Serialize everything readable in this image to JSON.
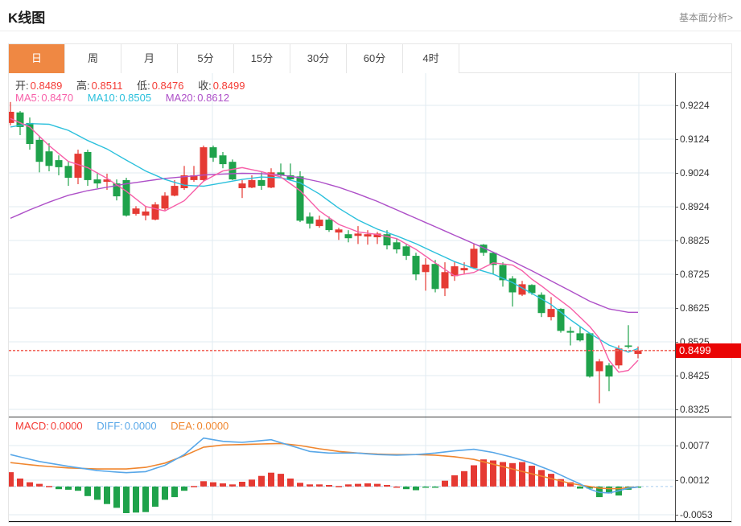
{
  "header": {
    "title": "K线图",
    "link": "基本面分析>"
  },
  "tabs": {
    "items": [
      "日",
      "周",
      "月",
      "5分",
      "15分",
      "30分",
      "60分",
      "4时"
    ],
    "active": 0
  },
  "legend": {
    "ohlc": [
      {
        "label": "开:",
        "value": "0.8489"
      },
      {
        "label": "高:",
        "value": "0.8511"
      },
      {
        "label": "低:",
        "value": "0.8476"
      },
      {
        "label": "收:",
        "value": "0.8499"
      }
    ],
    "ma": [
      {
        "label": "MA5:",
        "value": "0.8470"
      },
      {
        "label": "MA10:",
        "value": "0.8505"
      },
      {
        "label": "MA20:",
        "value": "0.8612"
      }
    ],
    "macd": [
      {
        "label": "MACD:",
        "value": "0.0000"
      },
      {
        "label": "DIFF:",
        "value": "0.0000"
      },
      {
        "label": "DEA:",
        "value": "0.0000"
      }
    ]
  },
  "colors": {
    "up": "#e53a33",
    "down": "#1fa24b",
    "ma5": "#f75fa8",
    "ma10": "#2bc0dc",
    "ma20": "#ae50c8",
    "diff": "#58a7e8",
    "dea": "#f0862e",
    "ohlc_value": "#f43b35",
    "grid": "#e2ebf2",
    "zero_line": "#a8cdf0",
    "dotted_line": "#f26a60",
    "badge_bg": "#ea0505",
    "axis_line": "#4a4a4a",
    "tick_text": "#333333",
    "tab_active_bg": "#ef8843"
  },
  "chart_data": {
    "type": "candlestick+macd",
    "main": {
      "y_ticks": [
        0.9224,
        0.9124,
        0.9024,
        0.8924,
        0.8825,
        0.8725,
        0.8625,
        0.8525,
        0.8425,
        0.8325
      ],
      "current_price": 0.8499,
      "candles": [
        [
          0.9172,
          0.9234,
          0.9165,
          0.9205
        ],
        [
          0.9203,
          0.9207,
          0.9136,
          0.916
        ],
        [
          0.9172,
          0.9188,
          0.9093,
          0.911
        ],
        [
          0.9122,
          0.9134,
          0.9026,
          0.9057
        ],
        [
          0.9088,
          0.9112,
          0.9029,
          0.9045
        ],
        [
          0.9062,
          0.9076,
          0.9017,
          0.9041
        ],
        [
          0.9045,
          0.9057,
          0.8986,
          0.901
        ],
        [
          0.901,
          0.9093,
          0.8991,
          0.9081
        ],
        [
          0.9086,
          0.9093,
          0.8986,
          0.9003
        ],
        [
          0.9005,
          0.9026,
          0.8979,
          0.8993
        ],
        [
          0.8998,
          0.9022,
          0.8974,
          0.9005
        ],
        [
          0.8993,
          0.9005,
          0.8943,
          0.8955
        ],
        [
          0.9003,
          0.901,
          0.8895,
          0.8898
        ],
        [
          0.8903,
          0.8926,
          0.8898,
          0.8919
        ],
        [
          0.8898,
          0.8926,
          0.8884,
          0.891
        ],
        [
          0.8886,
          0.8938,
          0.8884,
          0.8931
        ],
        [
          0.8919,
          0.8967,
          0.8914,
          0.8957
        ],
        [
          0.8957,
          0.9003,
          0.8955,
          0.8986
        ],
        [
          0.8979,
          0.9045,
          0.8974,
          0.9017
        ],
        [
          0.9003,
          0.9045,
          0.8998,
          0.9017
        ],
        [
          0.9003,
          0.9105,
          0.8998,
          0.91
        ],
        [
          0.91,
          0.9105,
          0.9057,
          0.9069
        ],
        [
          0.9076,
          0.9086,
          0.9038,
          0.905
        ],
        [
          0.9057,
          0.9064,
          0.9003,
          0.9005
        ],
        [
          0.8979,
          0.9003,
          0.895,
          0.8993
        ],
        [
          0.8981,
          0.9017,
          0.8979,
          0.9003
        ],
        [
          0.9003,
          0.9026,
          0.8974,
          0.8986
        ],
        [
          0.8981,
          0.9038,
          0.8979,
          0.9026
        ],
        [
          0.9026,
          0.9052,
          0.901,
          0.9017
        ],
        [
          0.9017,
          0.9052,
          0.9003,
          0.9005
        ],
        [
          0.9014,
          0.9029,
          0.8879,
          0.8883
        ],
        [
          0.8895,
          0.8907,
          0.886,
          0.8874
        ],
        [
          0.8867,
          0.8898,
          0.8862,
          0.8886
        ],
        [
          0.8886,
          0.8895,
          0.885,
          0.8855
        ],
        [
          0.8848,
          0.8862,
          0.8826,
          0.8857
        ],
        [
          0.8843,
          0.8855,
          0.8819,
          0.8831
        ],
        [
          0.8838,
          0.8867,
          0.8814,
          0.8845
        ],
        [
          0.8836,
          0.8855,
          0.8812,
          0.8843
        ],
        [
          0.8834,
          0.885,
          0.8814,
          0.8845
        ],
        [
          0.8843,
          0.8855,
          0.8798,
          0.881
        ],
        [
          0.8819,
          0.8831,
          0.8786,
          0.8798
        ],
        [
          0.8807,
          0.8814,
          0.8767,
          0.8779
        ],
        [
          0.8779,
          0.8788,
          0.8707,
          0.8724
        ],
        [
          0.8731,
          0.8772,
          0.8676,
          0.8753
        ],
        [
          0.8755,
          0.8767,
          0.8671,
          0.8681
        ],
        [
          0.8683,
          0.876,
          0.866,
          0.8731
        ],
        [
          0.8719,
          0.876,
          0.8705,
          0.8748
        ],
        [
          0.8736,
          0.876,
          0.8724,
          0.8743
        ],
        [
          0.8743,
          0.8814,
          0.874,
          0.88
        ],
        [
          0.8812,
          0.8814,
          0.8779,
          0.8788
        ],
        [
          0.8788,
          0.8791,
          0.8724,
          0.8752
        ],
        [
          0.8752,
          0.876,
          0.8688,
          0.8707
        ],
        [
          0.8712,
          0.8719,
          0.8629,
          0.8671
        ],
        [
          0.8664,
          0.8705,
          0.866,
          0.8695
        ],
        [
          0.8693,
          0.8695,
          0.8664,
          0.8669
        ],
        [
          0.8664,
          0.8671,
          0.8598,
          0.861
        ],
        [
          0.8598,
          0.8657,
          0.8588,
          0.8622
        ],
        [
          0.8622,
          0.8624,
          0.8552,
          0.8557
        ],
        [
          0.8557,
          0.8569,
          0.8514,
          0.8552
        ],
        [
          0.855,
          0.8569,
          0.8526,
          0.8529
        ],
        [
          0.855,
          0.8552,
          0.8419,
          0.8422
        ],
        [
          0.8438,
          0.8474,
          0.8343,
          0.8467
        ],
        [
          0.8455,
          0.8462,
          0.8379,
          0.8422
        ],
        [
          0.8455,
          0.8514,
          0.8445,
          0.8505
        ],
        [
          0.8514,
          0.8574,
          0.8505,
          0.851
        ],
        [
          0.8489,
          0.8511,
          0.8476,
          0.8499
        ]
      ],
      "ma5_points": [
        [
          0,
          0.9185
        ],
        [
          2,
          0.916
        ],
        [
          4,
          0.9105
        ],
        [
          6,
          0.9058
        ],
        [
          8,
          0.904
        ],
        [
          10,
          0.9008
        ],
        [
          12,
          0.897
        ],
        [
          14,
          0.8925
        ],
        [
          16,
          0.8912
        ],
        [
          18,
          0.8942
        ],
        [
          20,
          0.9
        ],
        [
          22,
          0.903
        ],
        [
          24,
          0.904
        ],
        [
          26,
          0.9028
        ],
        [
          28,
          0.9012
        ],
        [
          30,
          0.8972
        ],
        [
          32,
          0.8912
        ],
        [
          34,
          0.8872
        ],
        [
          36,
          0.885
        ],
        [
          38,
          0.8842
        ],
        [
          40,
          0.883
        ],
        [
          42,
          0.8798
        ],
        [
          44,
          0.8758
        ],
        [
          46,
          0.872
        ],
        [
          48,
          0.873
        ],
        [
          50,
          0.8758
        ],
        [
          52,
          0.8752
        ],
        [
          53,
          0.8735
        ],
        [
          54,
          0.871
        ],
        [
          55,
          0.869
        ],
        [
          56,
          0.8668
        ],
        [
          58,
          0.8625
        ],
        [
          60,
          0.857
        ],
        [
          61,
          0.8535
        ],
        [
          62,
          0.847
        ],
        [
          63,
          0.8435
        ],
        [
          64,
          0.844
        ],
        [
          65,
          0.847
        ]
      ],
      "ma10_points": [
        [
          0,
          0.916
        ],
        [
          2,
          0.917
        ],
        [
          4,
          0.9168
        ],
        [
          6,
          0.915
        ],
        [
          8,
          0.912
        ],
        [
          10,
          0.9095
        ],
        [
          12,
          0.9062
        ],
        [
          14,
          0.903
        ],
        [
          16,
          0.9005
        ],
        [
          18,
          0.8988
        ],
        [
          20,
          0.8985
        ],
        [
          22,
          0.8995
        ],
        [
          24,
          0.9005
        ],
        [
          26,
          0.9012
        ],
        [
          28,
          0.901
        ],
        [
          30,
          0.8995
        ],
        [
          32,
          0.8962
        ],
        [
          34,
          0.892
        ],
        [
          36,
          0.8885
        ],
        [
          38,
          0.8858
        ],
        [
          40,
          0.8838
        ],
        [
          42,
          0.8815
        ],
        [
          44,
          0.8788
        ],
        [
          46,
          0.8762
        ],
        [
          48,
          0.8742
        ],
        [
          50,
          0.8725
        ],
        [
          52,
          0.87
        ],
        [
          54,
          0.8668
        ],
        [
          56,
          0.8635
        ],
        [
          58,
          0.859
        ],
        [
          60,
          0.855
        ],
        [
          62,
          0.8515
        ],
        [
          64,
          0.8494
        ],
        [
          65,
          0.8505
        ]
      ],
      "ma20_points": [
        [
          0,
          0.889
        ],
        [
          2,
          0.8915
        ],
        [
          4,
          0.8938
        ],
        [
          6,
          0.8958
        ],
        [
          8,
          0.8972
        ],
        [
          10,
          0.8982
        ],
        [
          12,
          0.8992
        ],
        [
          14,
          0.9
        ],
        [
          16,
          0.9008
        ],
        [
          18,
          0.9013
        ],
        [
          20,
          0.9018
        ],
        [
          22,
          0.9021
        ],
        [
          24,
          0.9023
        ],
        [
          26,
          0.9022
        ],
        [
          28,
          0.9018
        ],
        [
          30,
          0.901
        ],
        [
          32,
          0.8998
        ],
        [
          34,
          0.8982
        ],
        [
          36,
          0.8962
        ],
        [
          38,
          0.894
        ],
        [
          40,
          0.8915
        ],
        [
          42,
          0.889
        ],
        [
          44,
          0.8865
        ],
        [
          46,
          0.884
        ],
        [
          48,
          0.8815
        ],
        [
          50,
          0.879
        ],
        [
          52,
          0.8763
        ],
        [
          54,
          0.8735
        ],
        [
          56,
          0.8705
        ],
        [
          58,
          0.8675
        ],
        [
          60,
          0.8645
        ],
        [
          62,
          0.8622
        ],
        [
          64,
          0.8612
        ],
        [
          65,
          0.8612
        ]
      ]
    },
    "macd": {
      "y_ticks": [
        0.0077,
        0.0012,
        -0.0053
      ],
      "histogram": [
        0.0027,
        0.0015,
        0.0008,
        0.0005,
        0.0001,
        -0.0005,
        -0.0006,
        -0.0008,
        -0.0018,
        -0.0025,
        -0.0033,
        -0.004,
        -0.005,
        -0.0049,
        -0.0048,
        -0.0038,
        -0.0025,
        -0.002,
        -0.0008,
        0.0001,
        0.001,
        0.0008,
        0.0006,
        0.0004,
        0.0009,
        0.0013,
        0.002,
        0.0026,
        0.0024,
        0.0015,
        0.0007,
        0.0004,
        0.0004,
        0.0003,
        0.0001,
        0.0004,
        0.0005,
        0.0006,
        0.0005,
        0.0003,
        0.0,
        -0.0005,
        -0.0007,
        -0.0002,
        -0.0001,
        0.0011,
        0.0021,
        0.0029,
        0.004,
        0.0051,
        0.0049,
        0.0046,
        0.0044,
        0.0046,
        0.0039,
        0.0031,
        0.0024,
        0.0014,
        0.0008,
        -0.0004,
        -0.0004,
        -0.002,
        -0.0013,
        -0.0017,
        -0.0006,
        -0.0002
      ],
      "diff_points": [
        [
          0,
          0.006
        ],
        [
          3,
          0.0047
        ],
        [
          6,
          0.0038
        ],
        [
          9,
          0.003
        ],
        [
          12,
          0.0026
        ],
        [
          14,
          0.0028
        ],
        [
          16,
          0.004
        ],
        [
          18,
          0.006
        ],
        [
          20,
          0.0091
        ],
        [
          22,
          0.0085
        ],
        [
          24,
          0.0083
        ],
        [
          27,
          0.0088
        ],
        [
          29,
          0.0077
        ],
        [
          31,
          0.0066
        ],
        [
          33,
          0.0063
        ],
        [
          36,
          0.0063
        ],
        [
          38,
          0.006
        ],
        [
          40,
          0.0059
        ],
        [
          42,
          0.006
        ],
        [
          44,
          0.0063
        ],
        [
          46,
          0.0067
        ],
        [
          48,
          0.007
        ],
        [
          50,
          0.0064
        ],
        [
          52,
          0.0055
        ],
        [
          54,
          0.0044
        ],
        [
          56,
          0.003
        ],
        [
          58,
          0.0013
        ],
        [
          59,
          0.0005
        ],
        [
          60,
          -0.0005
        ],
        [
          61,
          -0.0011
        ],
        [
          62,
          -0.0012
        ],
        [
          63,
          -0.0008
        ],
        [
          64,
          -0.0003
        ],
        [
          65,
          -0.0001
        ]
      ],
      "dea_points": [
        [
          0,
          0.0045
        ],
        [
          3,
          0.0039
        ],
        [
          6,
          0.0035
        ],
        [
          9,
          0.0033
        ],
        [
          12,
          0.0033
        ],
        [
          14,
          0.0036
        ],
        [
          16,
          0.0044
        ],
        [
          18,
          0.0058
        ],
        [
          20,
          0.0074
        ],
        [
          22,
          0.0078
        ],
        [
          24,
          0.0079
        ],
        [
          26,
          0.008
        ],
        [
          28,
          0.0081
        ],
        [
          30,
          0.0077
        ],
        [
          32,
          0.0071
        ],
        [
          34,
          0.0066
        ],
        [
          36,
          0.0063
        ],
        [
          38,
          0.0061
        ],
        [
          40,
          0.006
        ],
        [
          42,
          0.006
        ],
        [
          44,
          0.0059
        ],
        [
          46,
          0.0056
        ],
        [
          48,
          0.0051
        ],
        [
          50,
          0.0042
        ],
        [
          52,
          0.0033
        ],
        [
          54,
          0.0024
        ],
        [
          56,
          0.0015
        ],
        [
          58,
          0.0006
        ],
        [
          60,
          0.0
        ],
        [
          61,
          -0.0003
        ],
        [
          62,
          -0.0004
        ],
        [
          63,
          -0.0004
        ],
        [
          64,
          -0.0002
        ],
        [
          65,
          -0.0001
        ]
      ]
    }
  }
}
